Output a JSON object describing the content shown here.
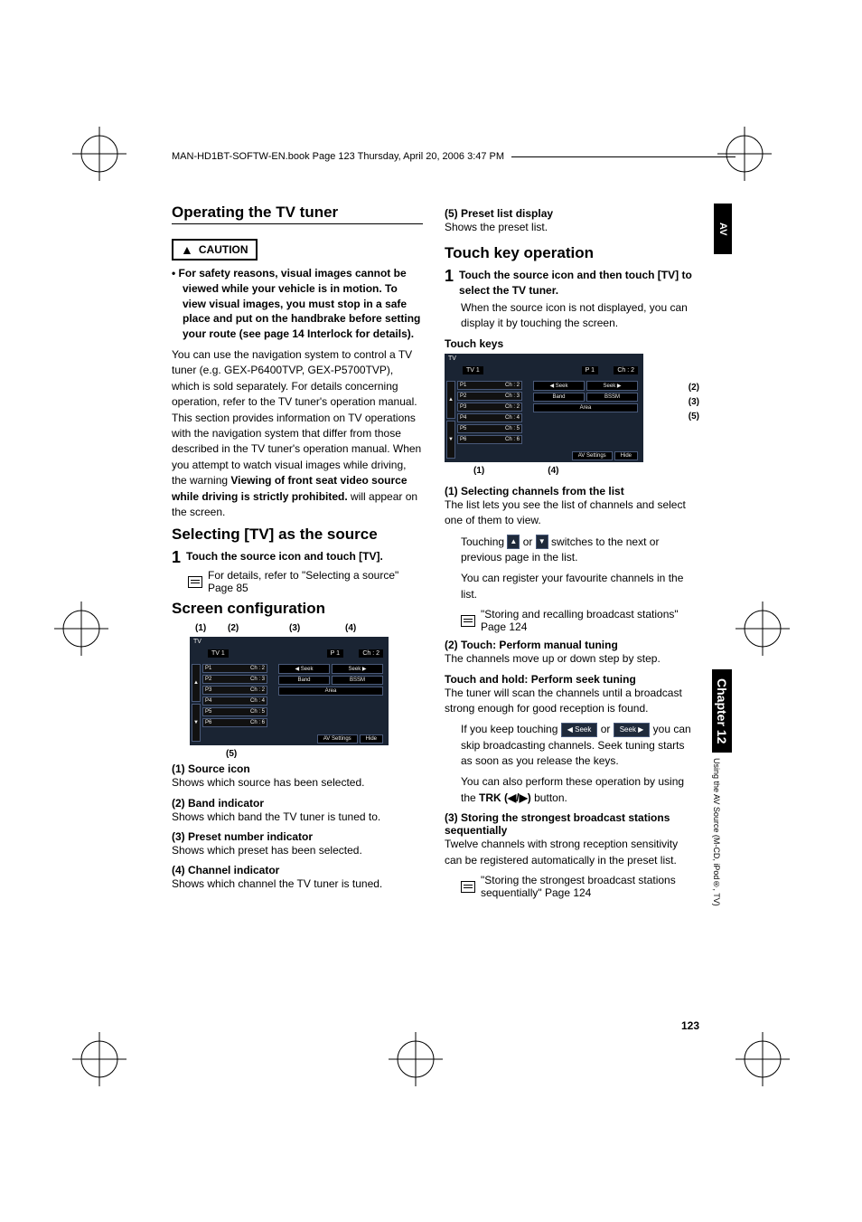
{
  "header": "MAN-HD1BT-SOFTW-EN.book  Page 123  Thursday, April 20, 2006  3:47 PM",
  "side_tab": "AV",
  "chapter_tab": "Chapter 12",
  "chapter_sub": "Using the AV Source (M-CD, iPod®, TV)",
  "page_number": "123",
  "left": {
    "h_operating": "Operating the TV tuner",
    "caution_label": "CAUTION",
    "caution_bullet": "For safety reasons, visual images cannot be viewed while your vehicle is in motion. To view visual images, you must stop in a safe place and put on the handbrake before setting your route (see page 14 Interlock for details).",
    "body1a": "You can use the navigation system to control a TV tuner (e.g. GEX-P6400TVP, GEX-P5700TVP), which is sold separately. For details concerning operation, refer to the TV tuner's operation manual. This section provides information on TV operations with the navigation system that differ from those described in the TV tuner's operation manual. When you attempt to watch visual images while driving, the warning ",
    "body1b": "Viewing of front seat video source while driving is strictly prohibited.",
    "body1c": " will appear on the screen.",
    "h_selecting": "Selecting [TV] as the source",
    "step1_num": "1",
    "step1_text": "Touch the source icon and touch [TV].",
    "step1_ref": "For details, refer to \"Selecting a source\" Page 85",
    "h_screen": "Screen configuration",
    "labels_top": [
      "(1)",
      "(2)",
      "(3)",
      "(4)"
    ],
    "label_bottom": "(5)",
    "screen": {
      "tv": "TV",
      "tv1": "TV 1",
      "preset": "P 1",
      "ch": "Ch : 2",
      "list": [
        {
          "p": "P1",
          "c": "Ch : 2"
        },
        {
          "p": "P2",
          "c": "Ch : 3"
        },
        {
          "p": "P3",
          "c": "Ch : 2"
        },
        {
          "p": "P4",
          "c": "Ch : 4"
        },
        {
          "p": "P5",
          "c": "Ch : 5"
        },
        {
          "p": "P6",
          "c": "Ch : 6"
        }
      ],
      "seek_l": "◀ Seek",
      "seek_r": "Seek ▶",
      "band": "Band",
      "bssm": "BSSM",
      "area": "Area",
      "avsettings": "AV Settings",
      "hide": "Hide"
    },
    "items": [
      {
        "h": "(1) Source icon",
        "t": "Shows which source has been selected."
      },
      {
        "h": "(2) Band indicator",
        "t": "Shows which band the TV tuner is tuned to."
      },
      {
        "h": "(3) Preset number indicator",
        "t": "Shows which preset has been selected."
      },
      {
        "h": "(4) Channel indicator",
        "t": "Shows which channel the TV tuner is tuned."
      }
    ]
  },
  "right": {
    "item5_h": "(5) Preset list display",
    "item5_t": "Shows the preset list.",
    "h_touch": "Touch key operation",
    "step1_num": "1",
    "step1_text": "Touch the source icon and then touch [TV] to select the TV tuner.",
    "step1_sub": "When the source icon is not displayed, you can display it by touching the screen.",
    "touch_keys_label": "Touch keys",
    "labels_right": [
      "(2)",
      "(3)",
      "(5)"
    ],
    "labels_bottom": [
      "(1)",
      "(4)"
    ],
    "sec1_h": "(1) Selecting channels from the list",
    "sec1_t": "The list lets you see the list of channels and select one of them to view.",
    "sec1_touch_a": "Touching ",
    "sec1_touch_b": " or ",
    "sec1_touch_c": " switches to the next or previous page in the list.",
    "sec1_reg": "You can register your favourite channels in the list.",
    "sec1_ref": "\"Storing and recalling broadcast stations\" Page 124",
    "sec2_h": "(2) Touch: Perform manual tuning",
    "sec2_t": "The channels move up or down step by step.",
    "sec2b_h": "Touch and hold: Perform seek tuning",
    "sec2b_t": "The tuner will scan the channels until a broadcast strong enough for good reception is found.",
    "sec2b_keep_a": "If you keep touching ",
    "sec2b_keep_b": " or ",
    "sec2b_keep_c": " you can skip broadcasting channels. Seek tuning starts as soon as you release the keys.",
    "sec2b_trk_a": "You can also perform these operation by using the ",
    "sec2b_trk_b": "TRK (◀/▶)",
    "sec2b_trk_c": " button.",
    "sec3_h": "(3) Storing the strongest broadcast stations sequentially",
    "sec3_t": "Twelve channels with strong reception sensitivity can be registered automatically in the preset list.",
    "sec3_ref": "\"Storing the strongest broadcast stations sequentially\"    Page 124"
  }
}
